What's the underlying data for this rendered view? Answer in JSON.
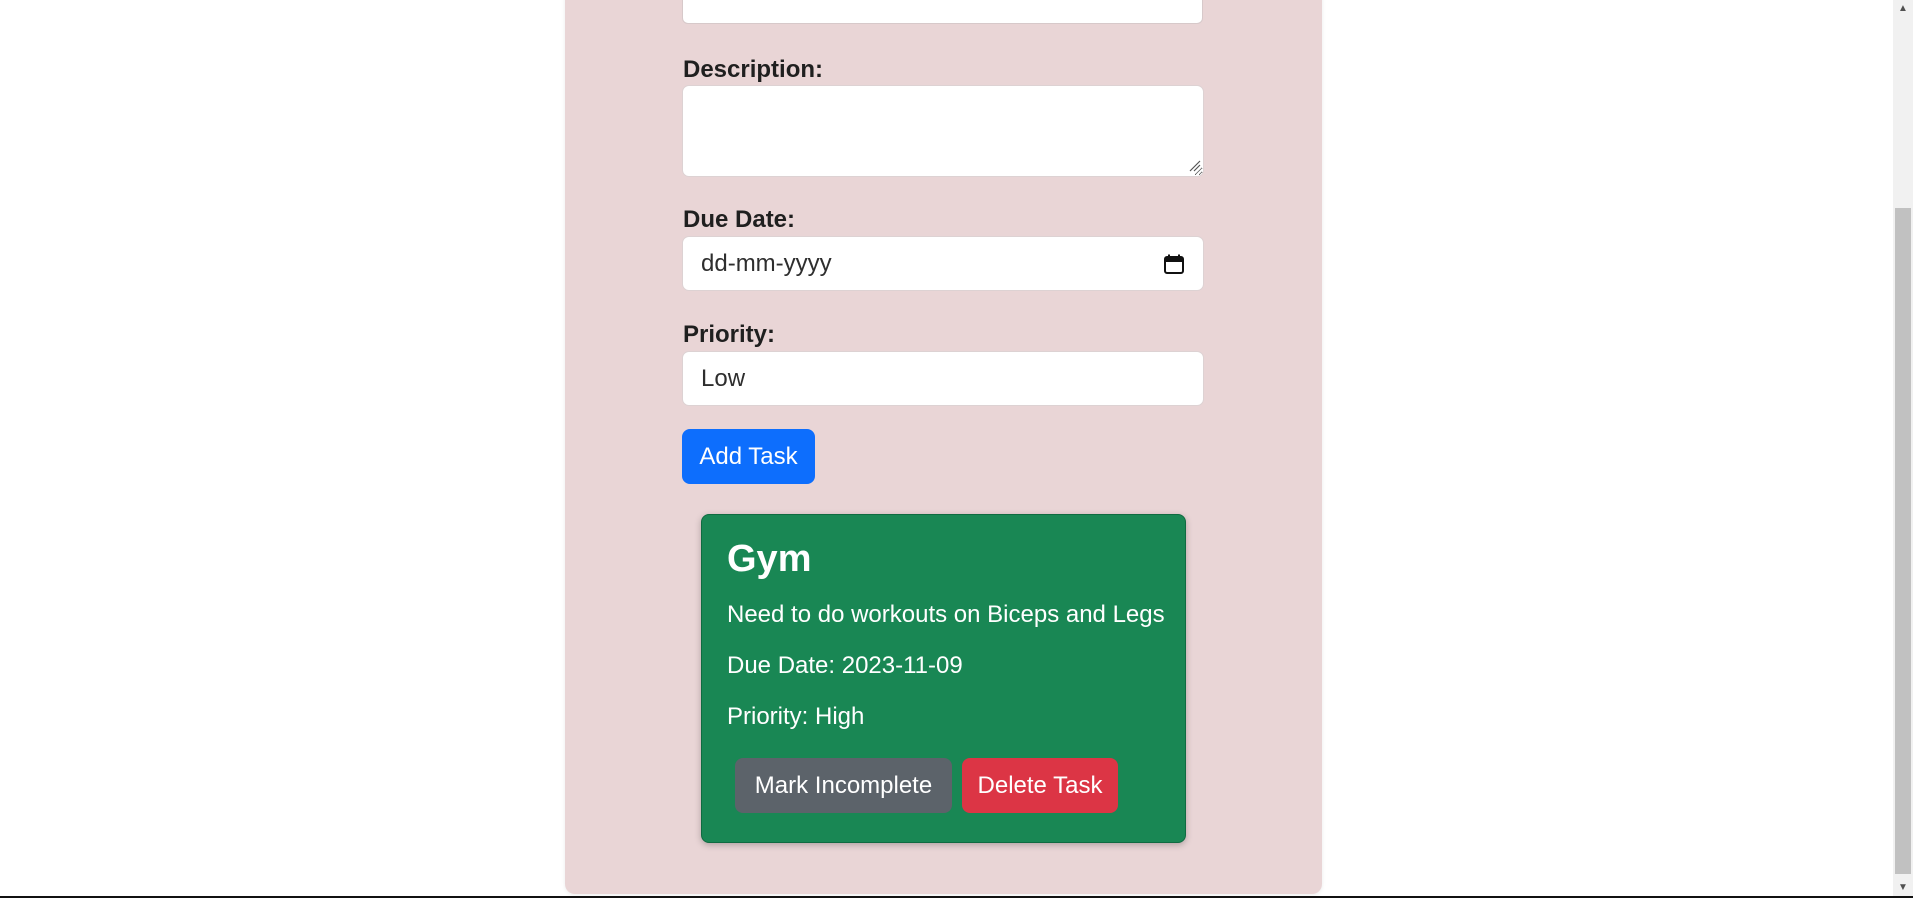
{
  "form": {
    "description_label": "Description:",
    "description_value": "",
    "due_date_label": "Due Date:",
    "due_date_placeholder": "dd-mm-yyyy",
    "priority_label": "Priority:",
    "priority_value": "Low",
    "add_button_label": "Add Task"
  },
  "task": {
    "title": "Gym",
    "description": "Need to do workouts on Biceps and Legs",
    "due_date_prefix": "Due Date: ",
    "due_date": "2023-11-09",
    "priority_prefix": "Priority: ",
    "priority": "High",
    "mark_button_label": "Mark Incomplete",
    "delete_button_label": "Delete Task"
  },
  "colors": {
    "panel": "#e9d5d6",
    "primary": "#0d6efd",
    "success": "#198754",
    "secondary": "#5c636a",
    "danger": "#dc3545"
  },
  "icons": {
    "calendar": "calendar-icon",
    "scroll_up": "scroll-up-icon",
    "scroll_down": "scroll-down-icon"
  }
}
